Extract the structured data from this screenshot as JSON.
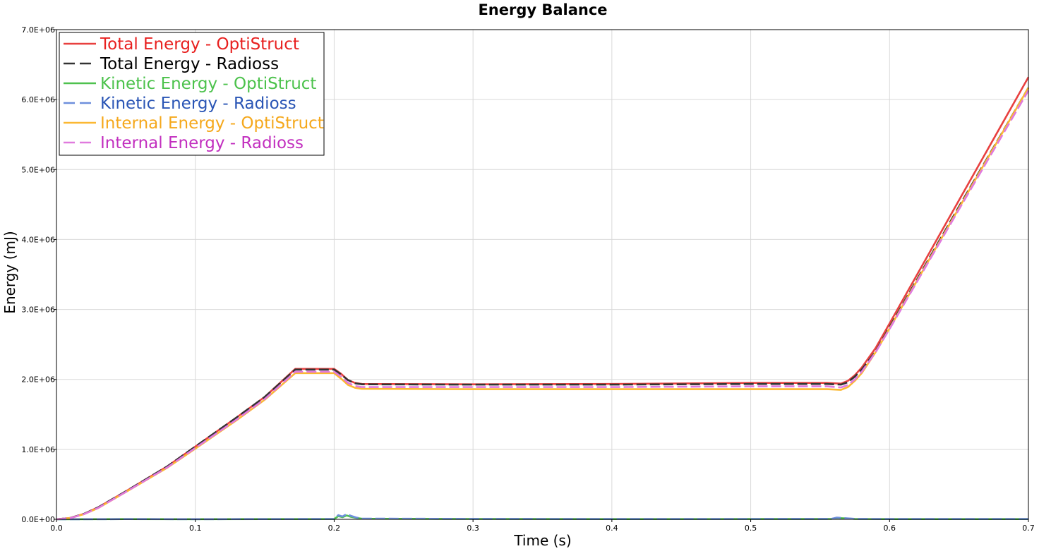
{
  "chart_data": {
    "type": "line",
    "title": "Energy Balance",
    "xlabel": "Time (s)",
    "ylabel": "Energy (mJ)",
    "xlim": [
      0.0,
      0.7
    ],
    "ylim": [
      0,
      7000000
    ],
    "x_ticks": [
      0.0,
      0.1,
      0.2,
      0.3,
      0.4,
      0.5,
      0.6,
      0.7
    ],
    "x_tick_labels": [
      "0.0",
      "0.1",
      "0.2",
      "0.3",
      "0.4",
      "0.5",
      "0.6",
      "0.7"
    ],
    "y_ticks": [
      0,
      1000000,
      2000000,
      3000000,
      4000000,
      5000000,
      6000000,
      7000000
    ],
    "y_tick_labels": [
      "0.0E+00",
      "1.0E+06",
      "2.0E+06",
      "3.0E+06",
      "4.0E+06",
      "5.0E+06",
      "6.0E+06",
      "7.0E+06"
    ],
    "grid": true,
    "legend_position": "top-left",
    "series": [
      {
        "name": "Total Energy - OptiStruct",
        "color": "#e8403f",
        "text_color": "#e8201f",
        "dash": "solid",
        "points": [
          [
            0.0,
            0
          ],
          [
            0.01,
            20000
          ],
          [
            0.02,
            80000
          ],
          [
            0.03,
            170000
          ],
          [
            0.05,
            400000
          ],
          [
            0.08,
            760000
          ],
          [
            0.1,
            1040000
          ],
          [
            0.13,
            1460000
          ],
          [
            0.15,
            1750000
          ],
          [
            0.172,
            2150000
          ],
          [
            0.2,
            2150000
          ],
          [
            0.205,
            2080000
          ],
          [
            0.21,
            1990000
          ],
          [
            0.215,
            1950000
          ],
          [
            0.22,
            1935000
          ],
          [
            0.3,
            1930000
          ],
          [
            0.4,
            1935000
          ],
          [
            0.5,
            1950000
          ],
          [
            0.555,
            1950000
          ],
          [
            0.565,
            1940000
          ],
          [
            0.57,
            1980000
          ],
          [
            0.575,
            2060000
          ],
          [
            0.58,
            2170000
          ],
          [
            0.59,
            2450000
          ],
          [
            0.6,
            2800000
          ],
          [
            0.65,
            4560000
          ],
          [
            0.7,
            6320000
          ]
        ]
      },
      {
        "name": "Total Energy - Radioss",
        "color": "#333333",
        "text_color": "#000000",
        "dash": "dashed",
        "points": [
          [
            0.0,
            0
          ],
          [
            0.01,
            20000
          ],
          [
            0.02,
            80000
          ],
          [
            0.03,
            170000
          ],
          [
            0.05,
            400000
          ],
          [
            0.08,
            760000
          ],
          [
            0.1,
            1040000
          ],
          [
            0.13,
            1460000
          ],
          [
            0.15,
            1750000
          ],
          [
            0.172,
            2140000
          ],
          [
            0.2,
            2140000
          ],
          [
            0.205,
            2070000
          ],
          [
            0.21,
            1990000
          ],
          [
            0.215,
            1945000
          ],
          [
            0.22,
            1930000
          ],
          [
            0.3,
            1925000
          ],
          [
            0.4,
            1925000
          ],
          [
            0.5,
            1935000
          ],
          [
            0.555,
            1935000
          ],
          [
            0.565,
            1925000
          ],
          [
            0.57,
            1960000
          ],
          [
            0.575,
            2040000
          ],
          [
            0.58,
            2140000
          ],
          [
            0.59,
            2400000
          ],
          [
            0.6,
            2750000
          ],
          [
            0.65,
            4470000
          ],
          [
            0.7,
            6170000
          ]
        ]
      },
      {
        "name": "Kinetic Energy - OptiStruct",
        "color": "#4fc14f",
        "text_color": "#4cc24c",
        "dash": "solid",
        "points": [
          [
            0.0,
            0
          ],
          [
            0.05,
            3000
          ],
          [
            0.1,
            2000
          ],
          [
            0.15,
            3000
          ],
          [
            0.2,
            4000
          ],
          [
            0.203,
            45000
          ],
          [
            0.206,
            30000
          ],
          [
            0.209,
            55000
          ],
          [
            0.212,
            35000
          ],
          [
            0.216,
            20000
          ],
          [
            0.22,
            8000
          ],
          [
            0.3,
            5000
          ],
          [
            0.4,
            3000
          ],
          [
            0.5,
            4000
          ],
          [
            0.558,
            5000
          ],
          [
            0.562,
            20000
          ],
          [
            0.567,
            15000
          ],
          [
            0.575,
            5000
          ],
          [
            0.6,
            3000
          ],
          [
            0.7,
            3000
          ]
        ]
      },
      {
        "name": "Kinetic Energy - Radioss",
        "color": "#6e8fdc",
        "text_color": "#2a55b5",
        "dash": "dashed",
        "points": [
          [
            0.0,
            0
          ],
          [
            0.05,
            3000
          ],
          [
            0.1,
            2000
          ],
          [
            0.15,
            3000
          ],
          [
            0.2,
            5000
          ],
          [
            0.203,
            60000
          ],
          [
            0.206,
            40000
          ],
          [
            0.209,
            75000
          ],
          [
            0.212,
            50000
          ],
          [
            0.216,
            25000
          ],
          [
            0.22,
            10000
          ],
          [
            0.3,
            6000
          ],
          [
            0.4,
            4000
          ],
          [
            0.5,
            5000
          ],
          [
            0.558,
            6000
          ],
          [
            0.562,
            25000
          ],
          [
            0.567,
            18000
          ],
          [
            0.575,
            6000
          ],
          [
            0.6,
            4000
          ],
          [
            0.7,
            4000
          ]
        ]
      },
      {
        "name": "Internal Energy - OptiStruct",
        "color": "#fbb832",
        "text_color": "#f5a81c",
        "dash": "solid",
        "points": [
          [
            0.0,
            0
          ],
          [
            0.01,
            18000
          ],
          [
            0.02,
            75000
          ],
          [
            0.03,
            160000
          ],
          [
            0.05,
            390000
          ],
          [
            0.08,
            740000
          ],
          [
            0.1,
            1010000
          ],
          [
            0.13,
            1420000
          ],
          [
            0.15,
            1710000
          ],
          [
            0.172,
            2090000
          ],
          [
            0.2,
            2090000
          ],
          [
            0.205,
            2010000
          ],
          [
            0.21,
            1920000
          ],
          [
            0.215,
            1880000
          ],
          [
            0.22,
            1865000
          ],
          [
            0.3,
            1860000
          ],
          [
            0.4,
            1860000
          ],
          [
            0.5,
            1860000
          ],
          [
            0.555,
            1860000
          ],
          [
            0.565,
            1850000
          ],
          [
            0.57,
            1890000
          ],
          [
            0.575,
            1980000
          ],
          [
            0.58,
            2090000
          ],
          [
            0.59,
            2390000
          ],
          [
            0.6,
            2730000
          ],
          [
            0.65,
            4450000
          ],
          [
            0.7,
            6170000
          ]
        ]
      },
      {
        "name": "Internal Energy - Radioss",
        "color": "#e07ade",
        "text_color": "#c22fbf",
        "dash": "dashed",
        "points": [
          [
            0.0,
            0
          ],
          [
            0.01,
            18000
          ],
          [
            0.02,
            75000
          ],
          [
            0.03,
            162000
          ],
          [
            0.05,
            392000
          ],
          [
            0.08,
            745000
          ],
          [
            0.1,
            1020000
          ],
          [
            0.13,
            1430000
          ],
          [
            0.15,
            1720000
          ],
          [
            0.172,
            2110000
          ],
          [
            0.2,
            2110000
          ],
          [
            0.205,
            2040000
          ],
          [
            0.21,
            1950000
          ],
          [
            0.215,
            1905000
          ],
          [
            0.22,
            1890000
          ],
          [
            0.3,
            1890000
          ],
          [
            0.4,
            1890000
          ],
          [
            0.5,
            1900000
          ],
          [
            0.555,
            1900000
          ],
          [
            0.565,
            1885000
          ],
          [
            0.57,
            1920000
          ],
          [
            0.575,
            2000000
          ],
          [
            0.58,
            2110000
          ],
          [
            0.59,
            2390000
          ],
          [
            0.6,
            2720000
          ],
          [
            0.65,
            4430000
          ],
          [
            0.7,
            6130000
          ]
        ]
      }
    ]
  }
}
